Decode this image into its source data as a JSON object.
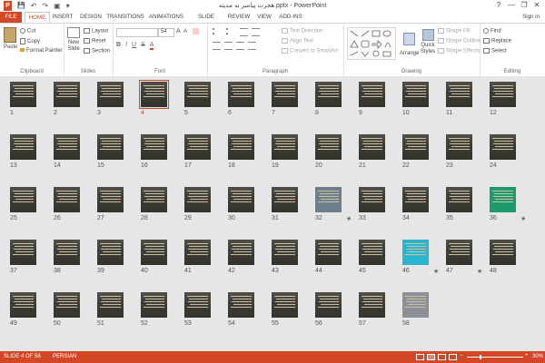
{
  "window": {
    "title": "هجرت پیامبر به مدینه.pptx - PowerPoint",
    "help": "?",
    "minimize": "—",
    "restore": "❐",
    "close": "✕"
  },
  "qat": {
    "save": "💾",
    "undo": "↶",
    "redo": "↷",
    "slideshow": "▣",
    "customize": "▾"
  },
  "tabs": [
    "FILE",
    "HOME",
    "INSERT",
    "DESIGN",
    "TRANSITIONS",
    "ANIMATIONS",
    "SLIDE SHOW",
    "REVIEW",
    "VIEW",
    "ADD-INS"
  ],
  "active_tab": "HOME",
  "sign_in": "Sign in",
  "ribbon": {
    "clipboard": {
      "paste": "Paste",
      "cut": "Cut",
      "copy": "Copy",
      "format_painter": "Format Painter",
      "label": "Clipboard"
    },
    "slides": {
      "new_slide": "New Slide",
      "layout": "Layout",
      "reset": "Reset",
      "section": "Section",
      "label": "Slides"
    },
    "font": {
      "size": "54",
      "label": "Font"
    },
    "paragraph": {
      "text_direction": "Text Direction",
      "align_text": "Align Text",
      "smartart": "Convert to SmartArt",
      "label": "Paragraph"
    },
    "drawing": {
      "arrange": "Arrange",
      "quick_styles": "Quick Styles",
      "shape_fill": "Shape Fill",
      "shape_outline": "Shape Outline",
      "shape_effects": "Shape Effects",
      "label": "Drawing"
    },
    "editing": {
      "find": "Find",
      "replace": "Replace",
      "select": "Select",
      "label": "Editing"
    }
  },
  "slides": {
    "selected": "4",
    "starred": [
      "32",
      "36",
      "46",
      "47"
    ],
    "numbers": [
      "1",
      "2",
      "3",
      "4",
      "5",
      "6",
      "7",
      "8",
      "9",
      "10",
      "11",
      "12",
      "13",
      "14",
      "15",
      "16",
      "17",
      "18",
      "19",
      "20",
      "21",
      "22",
      "23",
      "24",
      "25",
      "26",
      "27",
      "28",
      "29",
      "30",
      "31",
      "32",
      "33",
      "34",
      "35",
      "36",
      "37",
      "38",
      "39",
      "40",
      "41",
      "42",
      "43",
      "44",
      "45",
      "46",
      "47",
      "48",
      "49",
      "50",
      "51",
      "52",
      "53",
      "54",
      "55",
      "56",
      "57",
      "58"
    ]
  },
  "status": {
    "slide_of": "SLIDE 4 OF 58",
    "language": "PERSIAN",
    "zoom": "30%",
    "zoom_minus": "−",
    "zoom_plus": "+"
  },
  "colors": {
    "accent": "#d24726",
    "thumb_bg": "#3c3b33"
  }
}
